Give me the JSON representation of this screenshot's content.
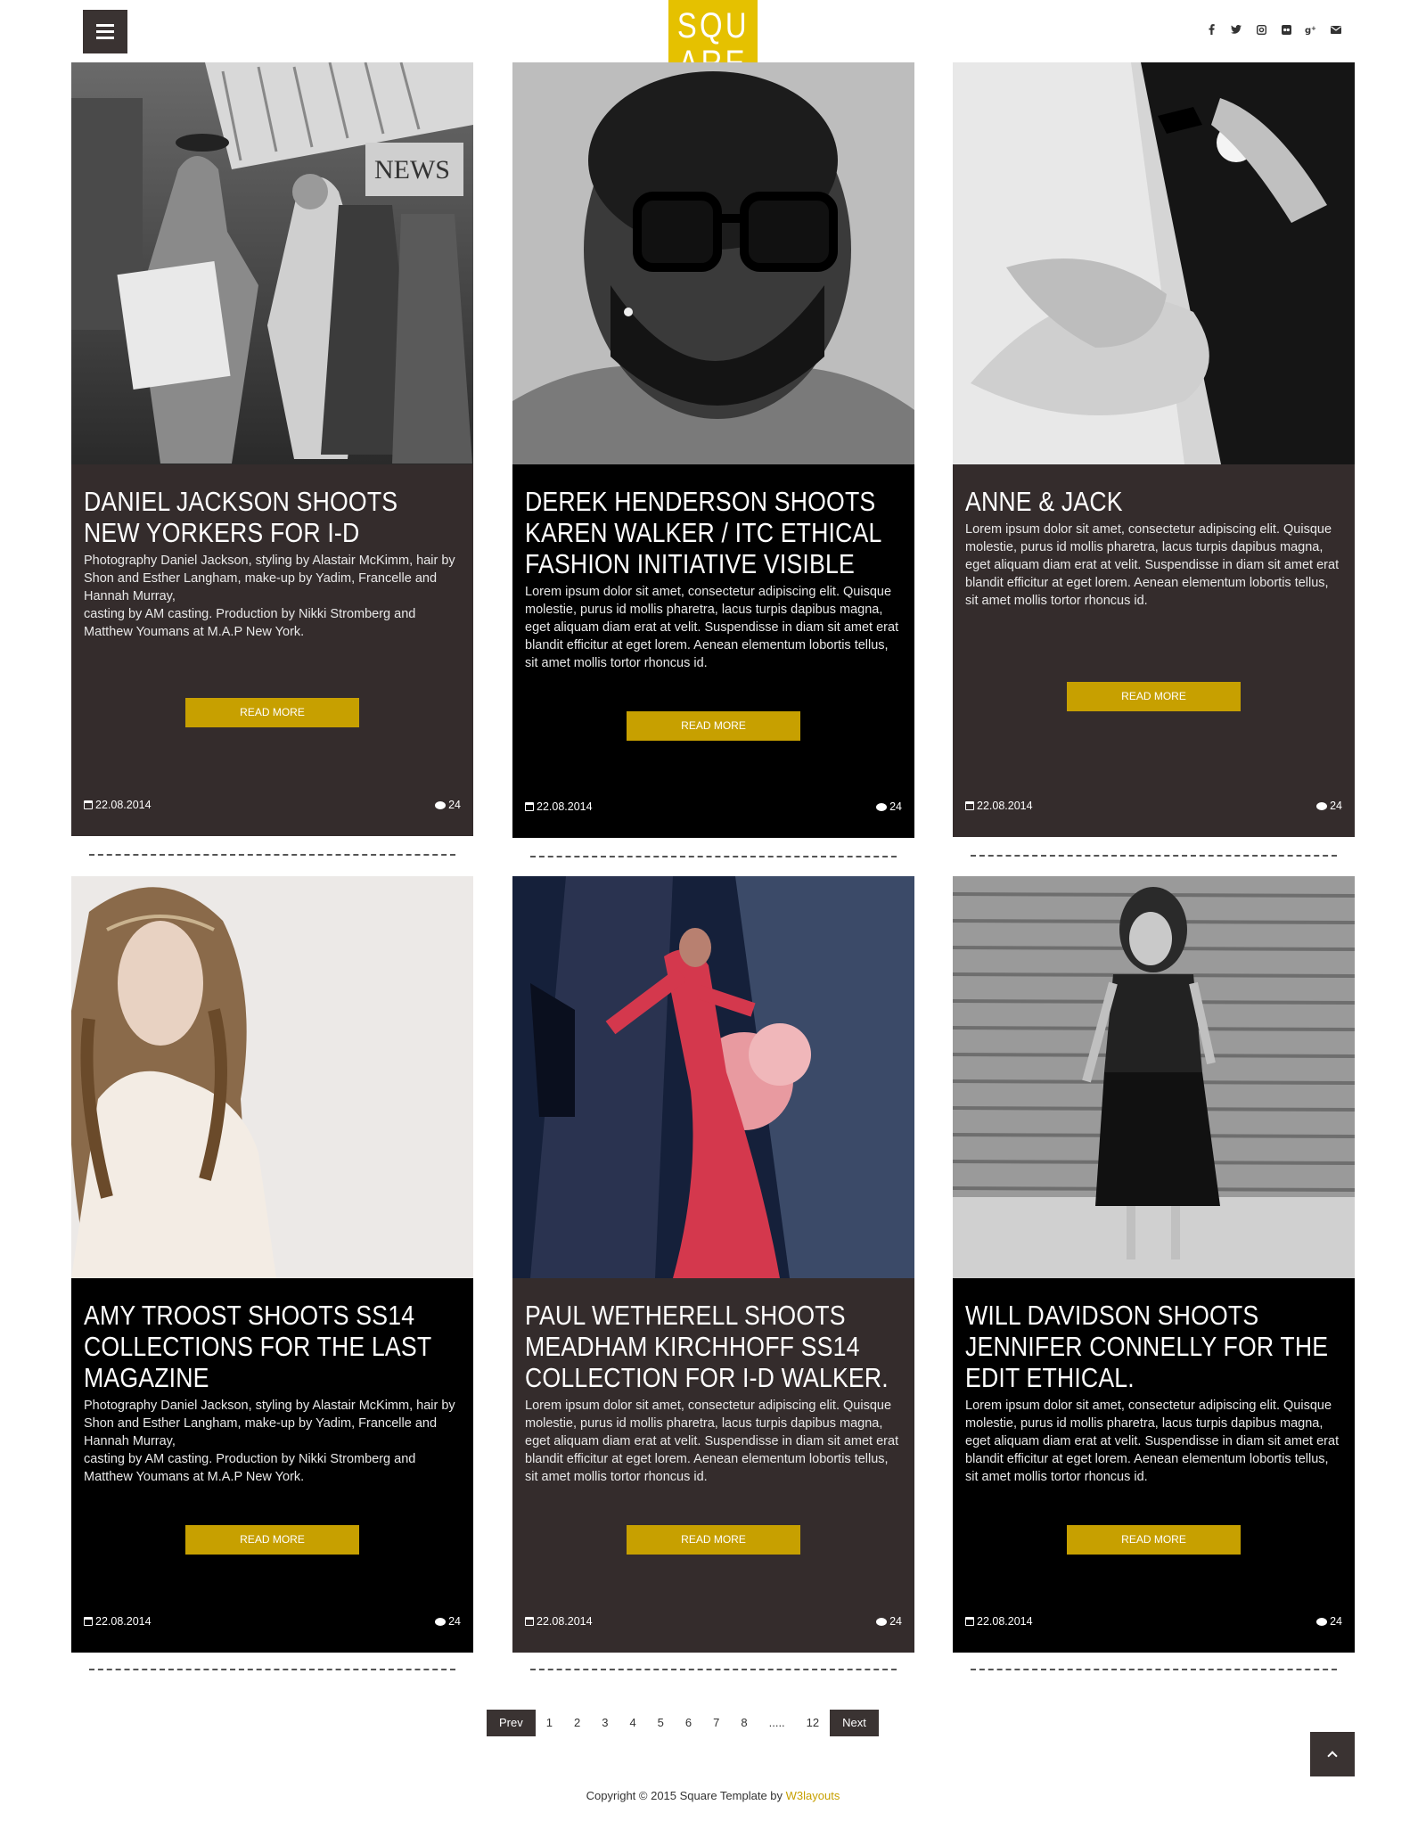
{
  "header": {
    "logo_line1": "SQU",
    "logo_line2": "ARE",
    "social": [
      "f",
      "t",
      "ig",
      "fl",
      "g+",
      "✉"
    ]
  },
  "posts": [
    {
      "title": "DANIEL JACKSON SHOOTS NEW YORKERS FOR I-D",
      "text": "Photography Daniel Jackson, styling by Alastair McKimm, hair by Shon and Esther Langham, make-up by Yadim, Francelle and Hannah Murray,\ncasting by AM casting. Production by Nikki Stromberg and Matthew Youmans at M.A.P New York.",
      "read_more": "READ MORE",
      "date": "22.08.2014",
      "comments": "24"
    },
    {
      "title": "DEREK HENDERSON SHOOTS KAREN WALKER / ITC ETHICAL FASHION INITIATIVE VISIBLE",
      "text": "Lorem ipsum dolor sit amet, consectetur adipiscing elit. Quisque molestie, purus id mollis pharetra, lacus turpis dapibus magna, eget aliquam diam erat at velit. Suspendisse in diam sit amet erat blandit efficitur at eget lorem. Aenean elementum lobortis tellus, sit amet mollis tortor rhoncus id.",
      "read_more": "READ MORE",
      "date": "22.08.2014",
      "comments": "24"
    },
    {
      "title": "ANNE & JACK",
      "text": "Lorem ipsum dolor sit amet, consectetur adipiscing elit. Quisque molestie, purus id mollis pharetra, lacus turpis dapibus magna, eget aliquam diam erat at velit. Suspendisse in diam sit amet erat blandit efficitur at eget lorem. Aenean elementum lobortis tellus, sit amet mollis tortor rhoncus id.",
      "read_more": "READ MORE",
      "date": "22.08.2014",
      "comments": "24"
    },
    {
      "title": "AMY TROOST SHOOTS SS14 COLLECTIONS FOR THE LAST MAGAZINE",
      "text": "Photography Daniel Jackson, styling by Alastair McKimm, hair by Shon and Esther Langham, make-up by Yadim, Francelle and Hannah Murray,\ncasting by AM casting. Production by Nikki Stromberg and Matthew Youmans at M.A.P New York.",
      "read_more": "READ MORE",
      "date": "22.08.2014",
      "comments": "24"
    },
    {
      "title": "PAUL WETHERELL SHOOTS MEADHAM KIRCHHOFF SS14 COLLECTION FOR I-D WALKER.",
      "text": "Lorem ipsum dolor sit amet, consectetur adipiscing elit. Quisque molestie, purus id mollis pharetra, lacus turpis dapibus magna, eget aliquam diam erat at velit. Suspendisse in diam sit amet erat blandit efficitur at eget lorem. Aenean elementum lobortis tellus, sit amet mollis tortor rhoncus id.",
      "read_more": "READ MORE",
      "date": "22.08.2014",
      "comments": "24"
    },
    {
      "title": "WILL DAVIDSON SHOOTS JENNIFER CONNELLY FOR THE EDIT ETHICAL.",
      "text": "Lorem ipsum dolor sit amet, consectetur adipiscing elit. Quisque molestie, purus id mollis pharetra, lacus turpis dapibus magna, eget aliquam diam erat at velit. Suspendisse in diam sit amet erat blandit efficitur at eget lorem. Aenean elementum lobortis tellus, sit amet mollis tortor rhoncus id.",
      "read_more": "READ MORE",
      "date": "22.08.2014",
      "comments": "24"
    }
  ],
  "pagination": {
    "prev": "Prev",
    "pages": [
      "1",
      "2",
      "3",
      "4",
      "5",
      "6",
      "7",
      "8",
      ".....",
      "12"
    ],
    "next": "Next"
  },
  "footer": {
    "text": "Copyright © 2015 Square Template by ",
    "link": "W3layouts"
  },
  "colors": {
    "accent": "#e5c100",
    "button": "#c7a000",
    "dark": "#000000",
    "brown": "#342c2c"
  }
}
